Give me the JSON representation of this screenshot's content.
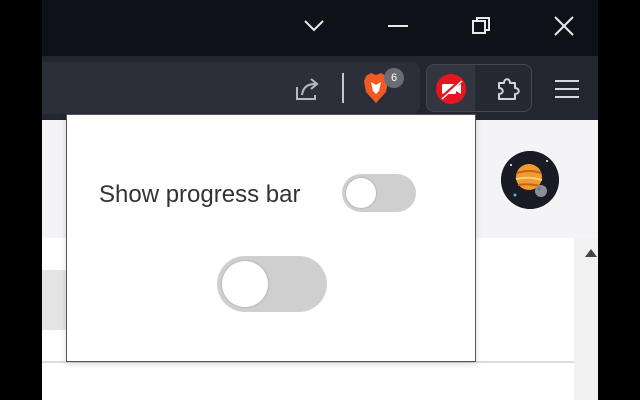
{
  "window_controls": {
    "dropdown_icon": "chevron-down-icon",
    "minimize_icon": "minimize-icon",
    "restore_icon": "restore-icon",
    "close_icon": "close-icon"
  },
  "toolbar": {
    "share_icon": "share-icon",
    "brave_icon": "brave-shields-icon",
    "brave_badge": "6",
    "extension_icon": "video-off-extension-icon",
    "extensions_puzzle_icon": "puzzle-icon",
    "menu_icon": "hamburger-menu-icon"
  },
  "popup": {
    "show_progress_bar_label": "Show progress bar",
    "show_progress_bar_on": false,
    "main_toggle_on": false
  },
  "page": {
    "avatar_icon": "planet-avatar-icon"
  },
  "colors": {
    "titlebar": "#0f1119",
    "toolbar": "#232530",
    "brave_orange": "#f15a22",
    "extension_red": "#e8141e",
    "toggle_off": "#cfcfcf"
  }
}
